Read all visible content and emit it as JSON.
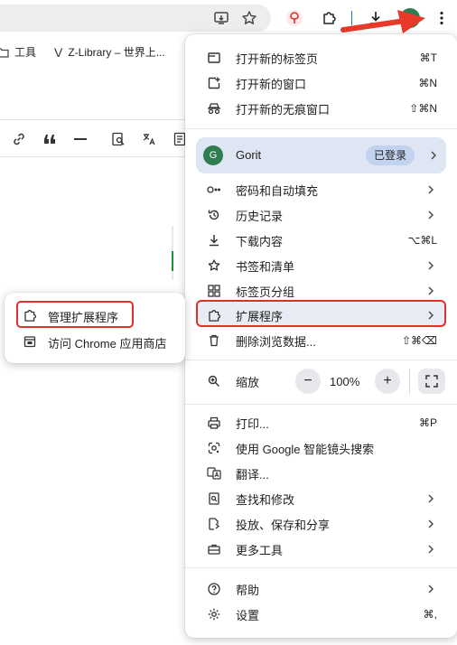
{
  "toolbar": {
    "avatar_letter": "G",
    "icons": [
      "install-app-icon",
      "bookmark-star-icon",
      "extension-red-icon",
      "extensions-puzzle-icon",
      "downloads-icon",
      "profile-avatar",
      "kebab-menu-icon"
    ]
  },
  "bookmarks": [
    {
      "label": "工具",
      "icon": "folder-icon"
    },
    {
      "label": "Z-Library – 世界上...",
      "icon": "zlibrary-icon"
    }
  ],
  "menu": {
    "new_tab": {
      "label": "打开新的标签页",
      "shortcut": "⌘T"
    },
    "new_window": {
      "label": "打开新的窗口",
      "shortcut": "⌘N"
    },
    "incognito": {
      "label": "打开新的无痕窗口",
      "shortcut": "⇧⌘N"
    },
    "profile": {
      "avatar": "G",
      "name": "Gorit",
      "status": "已登录"
    },
    "passwords": {
      "label": "密码和自动填充"
    },
    "history": {
      "label": "历史记录"
    },
    "downloads": {
      "label": "下载内容",
      "shortcut": "⌥⌘L"
    },
    "bookmarks": {
      "label": "书签和清单"
    },
    "tab_groups": {
      "label": "标签页分组"
    },
    "extensions": {
      "label": "扩展程序"
    },
    "clear_data": {
      "label": "删除浏览数据...",
      "shortcut": "⇧⌘⌫"
    },
    "zoom": {
      "label": "缩放",
      "value": "100%",
      "minus": "−",
      "plus": "+"
    },
    "print": {
      "label": "打印...",
      "shortcut": "⌘P"
    },
    "lens": {
      "label": "使用 Google 智能镜头搜索"
    },
    "translate": {
      "label": "翻译..."
    },
    "find": {
      "label": "查找和修改"
    },
    "cast": {
      "label": "投放、保存和分享"
    },
    "more_tools": {
      "label": "更多工具"
    },
    "help": {
      "label": "帮助"
    },
    "settings": {
      "label": "设置",
      "shortcut": "⌘,"
    }
  },
  "submenu": {
    "manage": {
      "label": "管理扩展程序"
    },
    "store": {
      "label": "访问 Chrome 应用商店"
    }
  },
  "colors": {
    "highlight_border": "#e0302a",
    "profile_bg": "#dfe6f3",
    "avatar_bg": "#2e7d4f"
  }
}
